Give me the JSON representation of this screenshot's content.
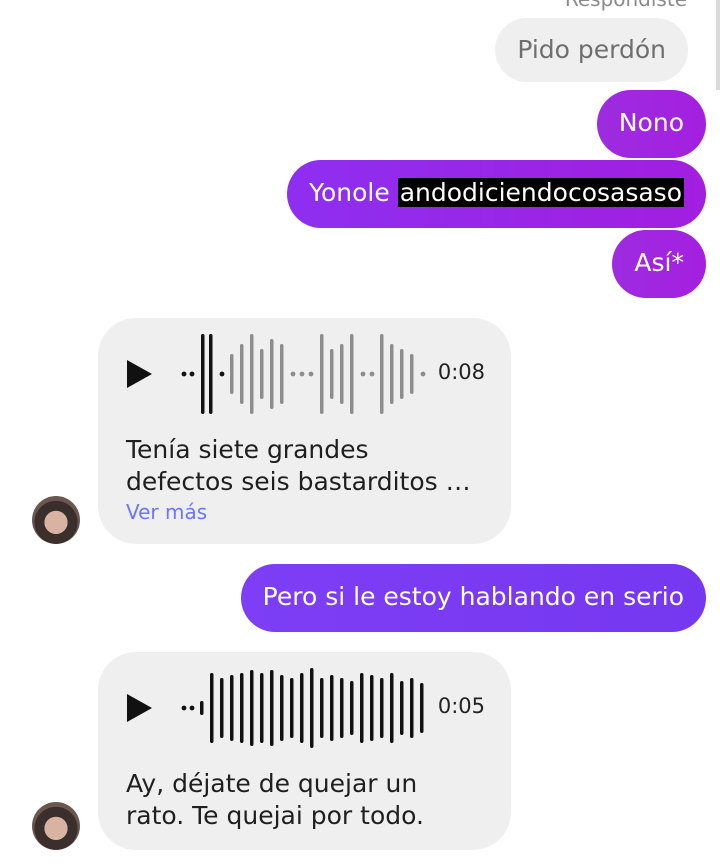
{
  "thread": {
    "reply_label": "Respondiste",
    "messages": [
      {
        "type": "text",
        "sender": "me",
        "text": "Pido perdón"
      },
      {
        "type": "text",
        "sender": "me",
        "text": "Nono"
      },
      {
        "type": "text",
        "sender": "me",
        "text_plain": "Yonole",
        "text_highlighted": "andodiciendocosasaso"
      },
      {
        "type": "text",
        "sender": "me",
        "text": "Así*"
      },
      {
        "type": "voice",
        "sender": "other",
        "duration": "0:08",
        "transcript_line1": "Tenía siete grandes",
        "transcript_line2": "defectos seis bastarditos …",
        "see_more": "Ver más"
      },
      {
        "type": "text",
        "sender": "me",
        "text": "Pero si le estoy hablando en serio"
      },
      {
        "type": "voice",
        "sender": "other",
        "duration": "0:05",
        "transcript_line1": "Ay, déjate de quejar un",
        "transcript_line2": "rato. Te quejai por todo."
      }
    ]
  },
  "colors": {
    "incoming_bubble": "#efefef",
    "outgoing_purple": "#a21ee0",
    "outgoing_violet": "#7a3cf4",
    "link": "#6e74ff"
  }
}
